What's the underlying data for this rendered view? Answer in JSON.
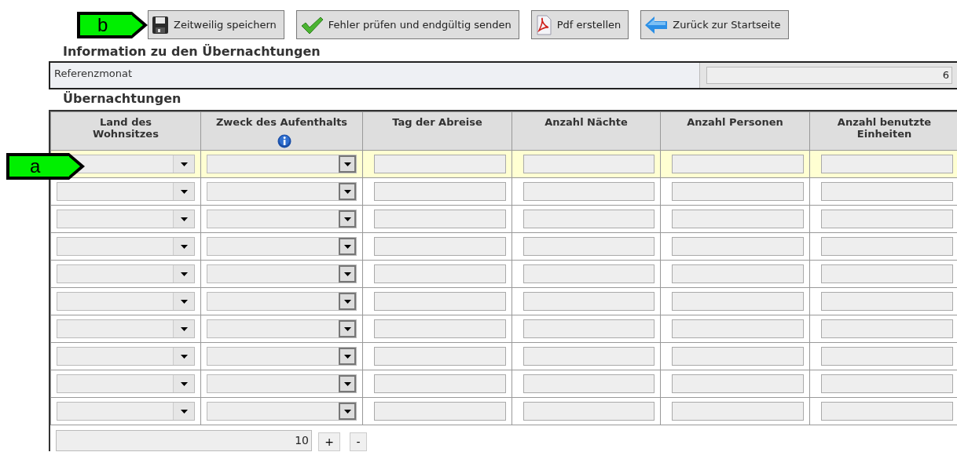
{
  "toolbar": {
    "buttons": [
      {
        "label": "Zeitweilig speichern",
        "kind": "save",
        "callout": "b"
      },
      {
        "label": "Fehler prüfen und endgültig senden",
        "kind": "submit"
      },
      {
        "label": "Pdf erstellen",
        "kind": "pdf"
      },
      {
        "label": "Zurück zur Startseite",
        "kind": "back"
      }
    ]
  },
  "info": {
    "title": "Information zu den Übernachtungen",
    "label": "Referenzmonat",
    "value": "6"
  },
  "overnights": {
    "title": "Übernachtungen",
    "columns": [
      {
        "label": "Land des Wohnsitzes",
        "kind": "select",
        "info_icon": false
      },
      {
        "label": "Zweck des Aufenthalts",
        "kind": "select2",
        "info_icon": true
      },
      {
        "label": "Tag der Abreise",
        "kind": "input",
        "info_icon": false
      },
      {
        "label": "Anzahl Nächte",
        "kind": "input",
        "info_icon": false
      },
      {
        "label": "Anzahl Personen",
        "kind": "input",
        "info_icon": false
      },
      {
        "label": "Anzahl benutzte Einheiten",
        "kind": "input",
        "info_icon": false
      }
    ],
    "rows": [
      {
        "selected": true,
        "callout": "a"
      },
      {
        "selected": false
      },
      {
        "selected": false
      },
      {
        "selected": false
      },
      {
        "selected": false
      },
      {
        "selected": false
      },
      {
        "selected": false
      },
      {
        "selected": false
      },
      {
        "selected": false
      },
      {
        "selected": false
      }
    ],
    "row_count": "10",
    "add_label": "+",
    "remove_label": "-"
  }
}
